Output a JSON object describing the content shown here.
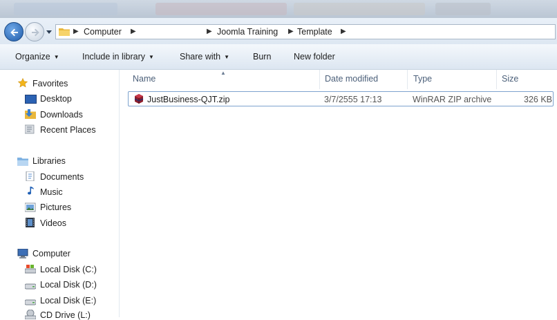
{
  "breadcrumb": {
    "items": [
      "Computer",
      "Joomla Training",
      "Template"
    ]
  },
  "toolbar": {
    "organize": "Organize",
    "include_in_library": "Include in library",
    "share_with": "Share with",
    "burn": "Burn",
    "new_folder": "New folder"
  },
  "nav": {
    "favorites_header": "Favorites",
    "favorites": [
      "Desktop",
      "Downloads",
      "Recent Places"
    ],
    "libraries_header": "Libraries",
    "libraries": [
      "Documents",
      "Music",
      "Pictures",
      "Videos"
    ],
    "computer_header": "Computer",
    "drives": [
      "Local Disk (C:)",
      "Local Disk (D:)",
      "Local Disk (E:)",
      "CD Drive (L:)"
    ]
  },
  "columns": {
    "name": "Name",
    "date_modified": "Date modified",
    "type": "Type",
    "size": "Size"
  },
  "files": [
    {
      "name": "JustBusiness-QJT.zip",
      "date_modified": "3/7/2555 17:13",
      "type": "WinRAR ZIP archive",
      "size": "326 KB"
    }
  ],
  "colors": {
    "selection_border": "#7da2ce",
    "header_text": "#4c607a",
    "accent_blue": "#1e5aa8"
  },
  "icons": {
    "back": "back-arrow-icon",
    "forward": "forward-arrow-icon",
    "folder": "folder-icon",
    "star": "star-icon",
    "zip": "winrar-archive-icon"
  }
}
